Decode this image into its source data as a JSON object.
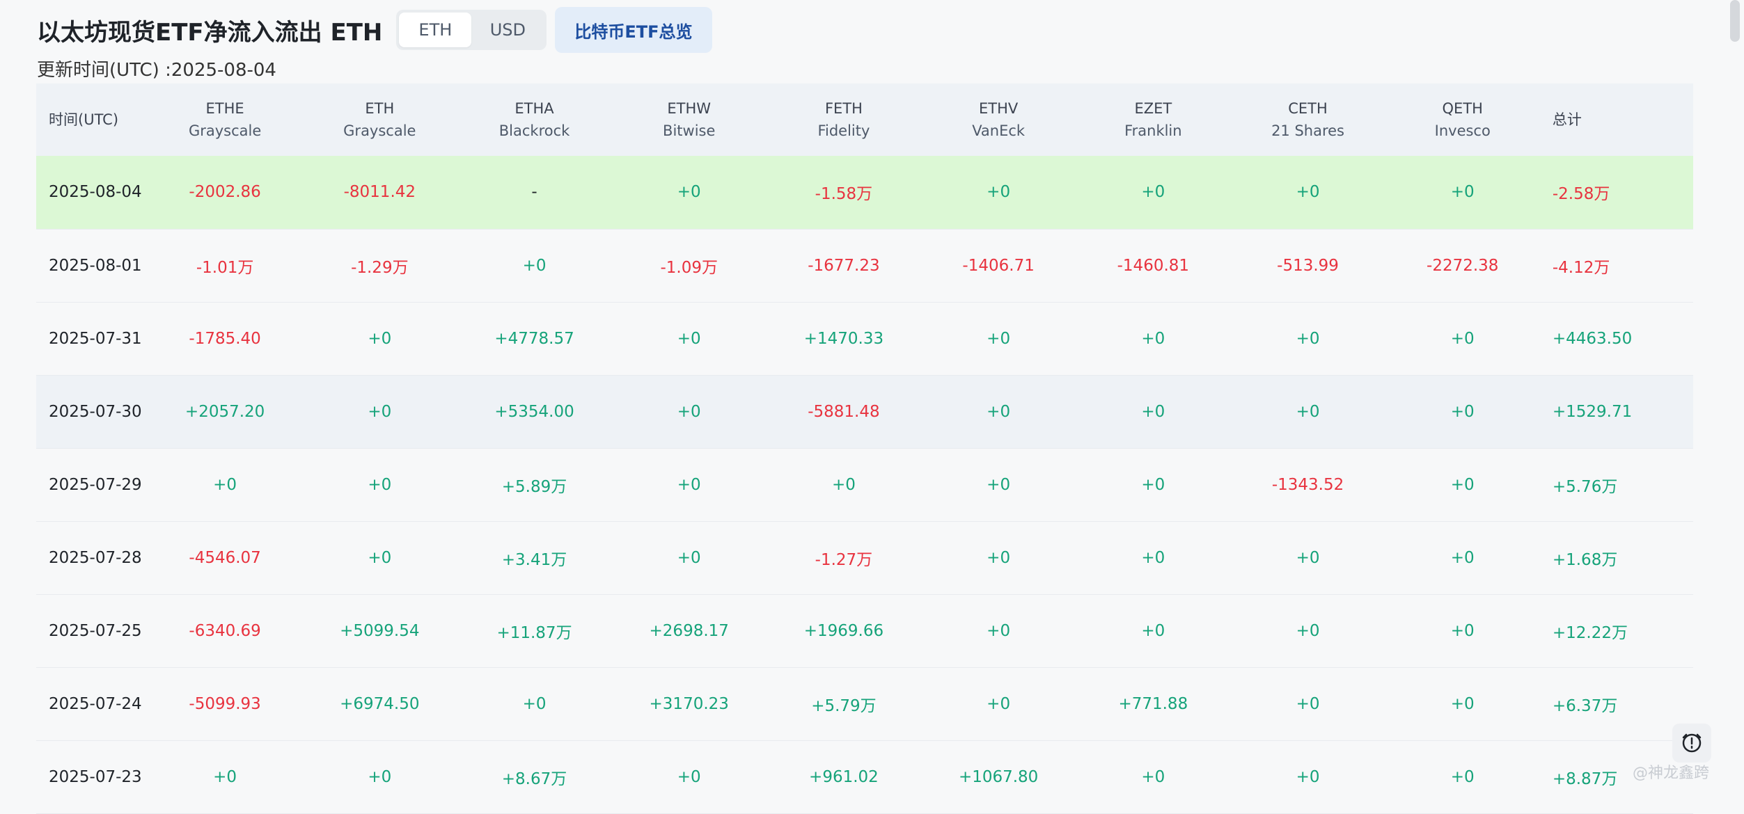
{
  "header": {
    "title": "以太坊现货ETF净流入流出 ETH",
    "toggle": {
      "eth_label": "ETH",
      "usd_label": "USD",
      "selected": "ETH"
    },
    "btc_overview_label": "比特币ETF总览",
    "updated": "更新时间(UTC) :2025-08-04"
  },
  "table": {
    "date_header": "时间(UTC)",
    "total_header": "总计",
    "columns": [
      {
        "ticker": "ETHE",
        "issuer": "Grayscale"
      },
      {
        "ticker": "ETH",
        "issuer": "Grayscale"
      },
      {
        "ticker": "ETHA",
        "issuer": "Blackrock"
      },
      {
        "ticker": "ETHW",
        "issuer": "Bitwise"
      },
      {
        "ticker": "FETH",
        "issuer": "Fidelity"
      },
      {
        "ticker": "ETHV",
        "issuer": "VanEck"
      },
      {
        "ticker": "EZET",
        "issuer": "Franklin"
      },
      {
        "ticker": "CETH",
        "issuer": "21 Shares"
      },
      {
        "ticker": "QETH",
        "issuer": "Invesco"
      }
    ],
    "rows": [
      {
        "date": "2025-08-04",
        "values": [
          "-2002.86",
          "-8011.42",
          "-",
          "+0",
          "-1.58万",
          "+0",
          "+0",
          "+0",
          "+0"
        ],
        "total": "-2.58万"
      },
      {
        "date": "2025-08-01",
        "values": [
          "-1.01万",
          "-1.29万",
          "+0",
          "-1.09万",
          "-1677.23",
          "-1406.71",
          "-1460.81",
          "-513.99",
          "-2272.38"
        ],
        "total": "-4.12万"
      },
      {
        "date": "2025-07-31",
        "values": [
          "-1785.40",
          "+0",
          "+4778.57",
          "+0",
          "+1470.33",
          "+0",
          "+0",
          "+0",
          "+0"
        ],
        "total": "+4463.50"
      },
      {
        "date": "2025-07-30",
        "values": [
          "+2057.20",
          "+0",
          "+5354.00",
          "+0",
          "-5881.48",
          "+0",
          "+0",
          "+0",
          "+0"
        ],
        "total": "+1529.71"
      },
      {
        "date": "2025-07-29",
        "values": [
          "+0",
          "+0",
          "+5.89万",
          "+0",
          "+0",
          "+0",
          "+0",
          "-1343.52",
          "+0"
        ],
        "total": "+5.76万"
      },
      {
        "date": "2025-07-28",
        "values": [
          "-4546.07",
          "+0",
          "+3.41万",
          "+0",
          "-1.27万",
          "+0",
          "+0",
          "+0",
          "+0"
        ],
        "total": "+1.68万"
      },
      {
        "date": "2025-07-25",
        "values": [
          "-6340.69",
          "+5099.54",
          "+11.87万",
          "+2698.17",
          "+1969.66",
          "+0",
          "+0",
          "+0",
          "+0"
        ],
        "total": "+12.22万"
      },
      {
        "date": "2025-07-24",
        "values": [
          "-5099.93",
          "+6974.50",
          "+0",
          "+3170.23",
          "+5.79万",
          "+0",
          "+771.88",
          "+0",
          "+0"
        ],
        "total": "+6.37万"
      },
      {
        "date": "2025-07-23",
        "values": [
          "+0",
          "+0",
          "+8.67万",
          "+0",
          "+961.02",
          "+1067.80",
          "+0",
          "+0",
          "+0"
        ],
        "total": "+8.87万"
      }
    ]
  },
  "watermark": "@神龙鑫跨",
  "colors": {
    "negative": "#e8333f",
    "positive": "#16a37a",
    "today_row": "#dcf8d5",
    "header_bg": "#eef2f6"
  },
  "icons": {
    "fab": "clock-alert-icon"
  }
}
